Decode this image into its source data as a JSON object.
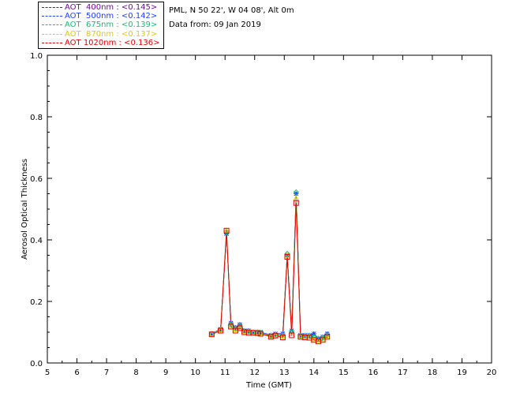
{
  "header": {
    "location": "PML, N 50 22', W 04 08', Alt 0m",
    "date_line": "Data from: 09 Jan 2019"
  },
  "legend": [
    {
      "label": "AOT  400nm : <0.145>",
      "color": "#7a00b4"
    },
    {
      "label": "AOT  500nm : <0.142>",
      "color": "#1f3cff"
    },
    {
      "label": "AOT  675nm : <0.139>",
      "color": "#00c878"
    },
    {
      "label": "AOT  870nm : <0.137>",
      "color": "#e6c800"
    },
    {
      "label": "AOT 1020nm : <0.136>",
      "color": "#e60000"
    }
  ],
  "chart_data": {
    "type": "line",
    "xlabel": "Time (GMT)",
    "ylabel": "Aerosol Optical Thickness",
    "xlim": [
      5,
      20
    ],
    "ylim": [
      0,
      1.0
    ],
    "xticks": [
      "5",
      "6",
      "7",
      "8",
      "9",
      "10",
      "11",
      "12",
      "13",
      "14",
      "15",
      "16",
      "17",
      "18",
      "19",
      "20"
    ],
    "yticks": [
      "0.0",
      "0.2",
      "0.4",
      "0.6",
      "0.8",
      "1.0"
    ],
    "x": [
      10.55,
      10.85,
      11.05,
      11.2,
      11.35,
      11.5,
      11.65,
      11.8,
      11.95,
      12.1,
      12.2,
      12.55,
      12.7,
      12.95,
      13.1,
      13.25,
      13.4,
      13.55,
      13.7,
      13.85,
      14.0,
      14.15,
      14.3,
      14.45
    ],
    "series": [
      {
        "name": "AOT  400nm",
        "values": [
          0.095,
          0.11,
          0.42,
          0.13,
          0.115,
          0.125,
          0.105,
          0.105,
          0.1,
          0.1,
          0.1,
          0.09,
          0.095,
          0.095,
          0.35,
          0.105,
          0.55,
          0.09,
          0.09,
          0.09,
          0.095,
          0.08,
          0.085,
          0.095
        ]
      },
      {
        "name": "AOT  500nm",
        "values": [
          0.095,
          0.11,
          0.42,
          0.13,
          0.115,
          0.125,
          0.105,
          0.105,
          0.1,
          0.1,
          0.1,
          0.09,
          0.095,
          0.095,
          0.35,
          0.105,
          0.55,
          0.09,
          0.09,
          0.09,
          0.095,
          0.08,
          0.085,
          0.095
        ]
      },
      {
        "name": "AOT  675nm",
        "values": [
          0.095,
          0.108,
          0.425,
          0.125,
          0.112,
          0.12,
          0.104,
          0.102,
          0.1,
          0.1,
          0.099,
          0.088,
          0.092,
          0.09,
          0.355,
          0.1,
          0.555,
          0.088,
          0.088,
          0.088,
          0.085,
          0.078,
          0.082,
          0.09
        ]
      },
      {
        "name": "AOT  870nm",
        "values": [
          0.094,
          0.107,
          0.43,
          0.12,
          0.108,
          0.115,
          0.102,
          0.1,
          0.099,
          0.098,
          0.097,
          0.086,
          0.09,
          0.086,
          0.35,
          0.095,
          0.535,
          0.086,
          0.085,
          0.085,
          0.078,
          0.072,
          0.078,
          0.087
        ]
      },
      {
        "name": "AOT 1020nm",
        "values": [
          0.093,
          0.105,
          0.43,
          0.118,
          0.105,
          0.113,
          0.1,
          0.098,
          0.098,
          0.097,
          0.095,
          0.085,
          0.089,
          0.083,
          0.345,
          0.09,
          0.52,
          0.085,
          0.083,
          0.082,
          0.075,
          0.07,
          0.075,
          0.085
        ]
      }
    ],
    "grid": false
  }
}
